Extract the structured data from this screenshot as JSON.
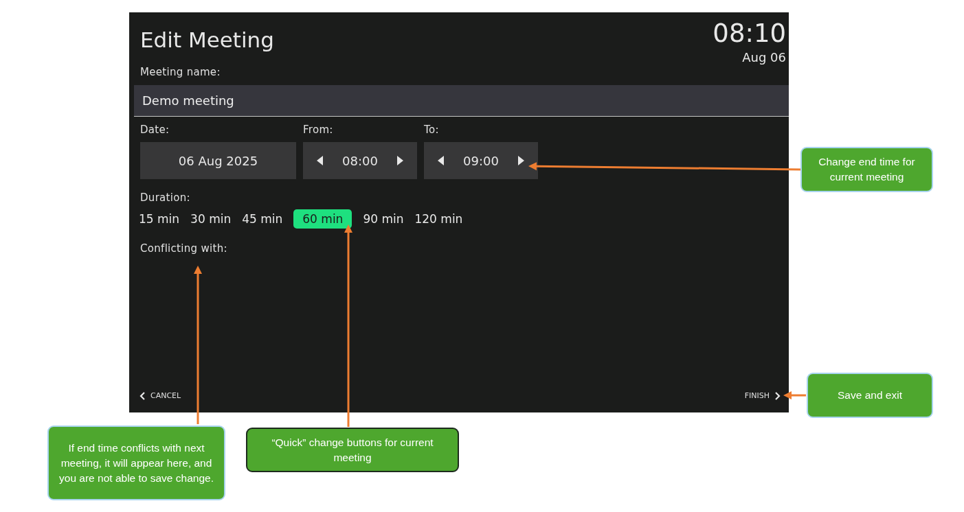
{
  "screen": {
    "title": "Edit Meeting",
    "clock": {
      "time": "08:10",
      "date": "Aug 06"
    },
    "name_field": {
      "label": "Meeting name:",
      "value": "Demo meeting"
    },
    "date": {
      "label": "Date:",
      "value": "06 Aug 2025"
    },
    "from": {
      "label": "From:",
      "value": "08:00"
    },
    "to": {
      "label": "To:",
      "value": "09:00"
    },
    "duration": {
      "label": "Duration:",
      "options": [
        {
          "label": "15 min",
          "selected": false
        },
        {
          "label": "30 min",
          "selected": false
        },
        {
          "label": "45 min",
          "selected": false
        },
        {
          "label": "60 min",
          "selected": true
        },
        {
          "label": "90 min",
          "selected": false
        },
        {
          "label": "120 min",
          "selected": false
        }
      ]
    },
    "conflicts": {
      "label": "Conflicting with:"
    },
    "cancel": "CANCEL",
    "finish": "FINISH"
  },
  "callouts": [
    {
      "text": "Change end time for current meeting"
    },
    {
      "text": "Save and exit"
    },
    {
      "text": "If end time conflicts with next meeting, it will appear here, and you are not able to save change."
    },
    {
      "text": "“Quick” change buttons for current meeting"
    }
  ]
}
